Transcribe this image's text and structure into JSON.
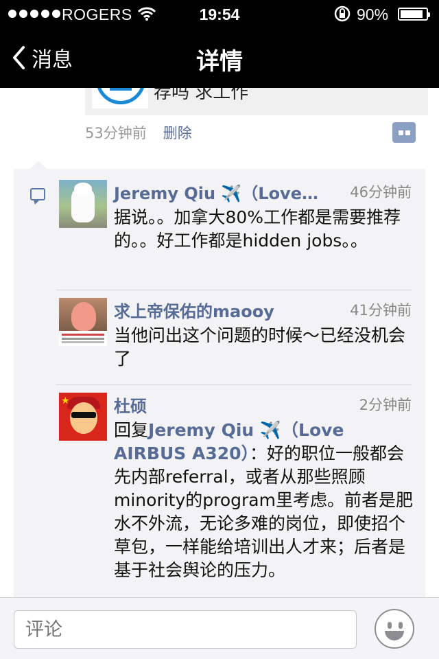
{
  "status_bar": {
    "carrier": "ROGERS",
    "time": "19:54",
    "battery": "90%"
  },
  "nav": {
    "back_label": "消息",
    "title": "详情"
  },
  "post": {
    "text_partial": "荐吗 求工作",
    "time_ago": "53分钟前",
    "delete_label": "删除"
  },
  "comments": [
    {
      "name": "Jeremy Qiu ✈️（Love…",
      "time": "46分钟前",
      "text": "据说。。加拿大80%工作都是需要推荐的。。好工作都是hidden jobs。。"
    },
    {
      "name": "求上帝保佑的maooy",
      "time": "41分钟前",
      "text": "当他问出这个问题的时候～已经没机会了"
    },
    {
      "name": "杜硕",
      "time": "2分钟前",
      "reply_prefix": "回复",
      "reply_target": "Jeremy Qiu ✈️（Love AIRBUS A320）",
      "text": "：好的职位一般都会先内部referral，或者从那些照顾minority的program里考虑。前者是肥水不外流，无论多难的岗位，即使招个草包，一样能给培训出人才来；后者是基于社会舆论的压力。"
    }
  ],
  "bottom": {
    "placeholder": "评论"
  }
}
